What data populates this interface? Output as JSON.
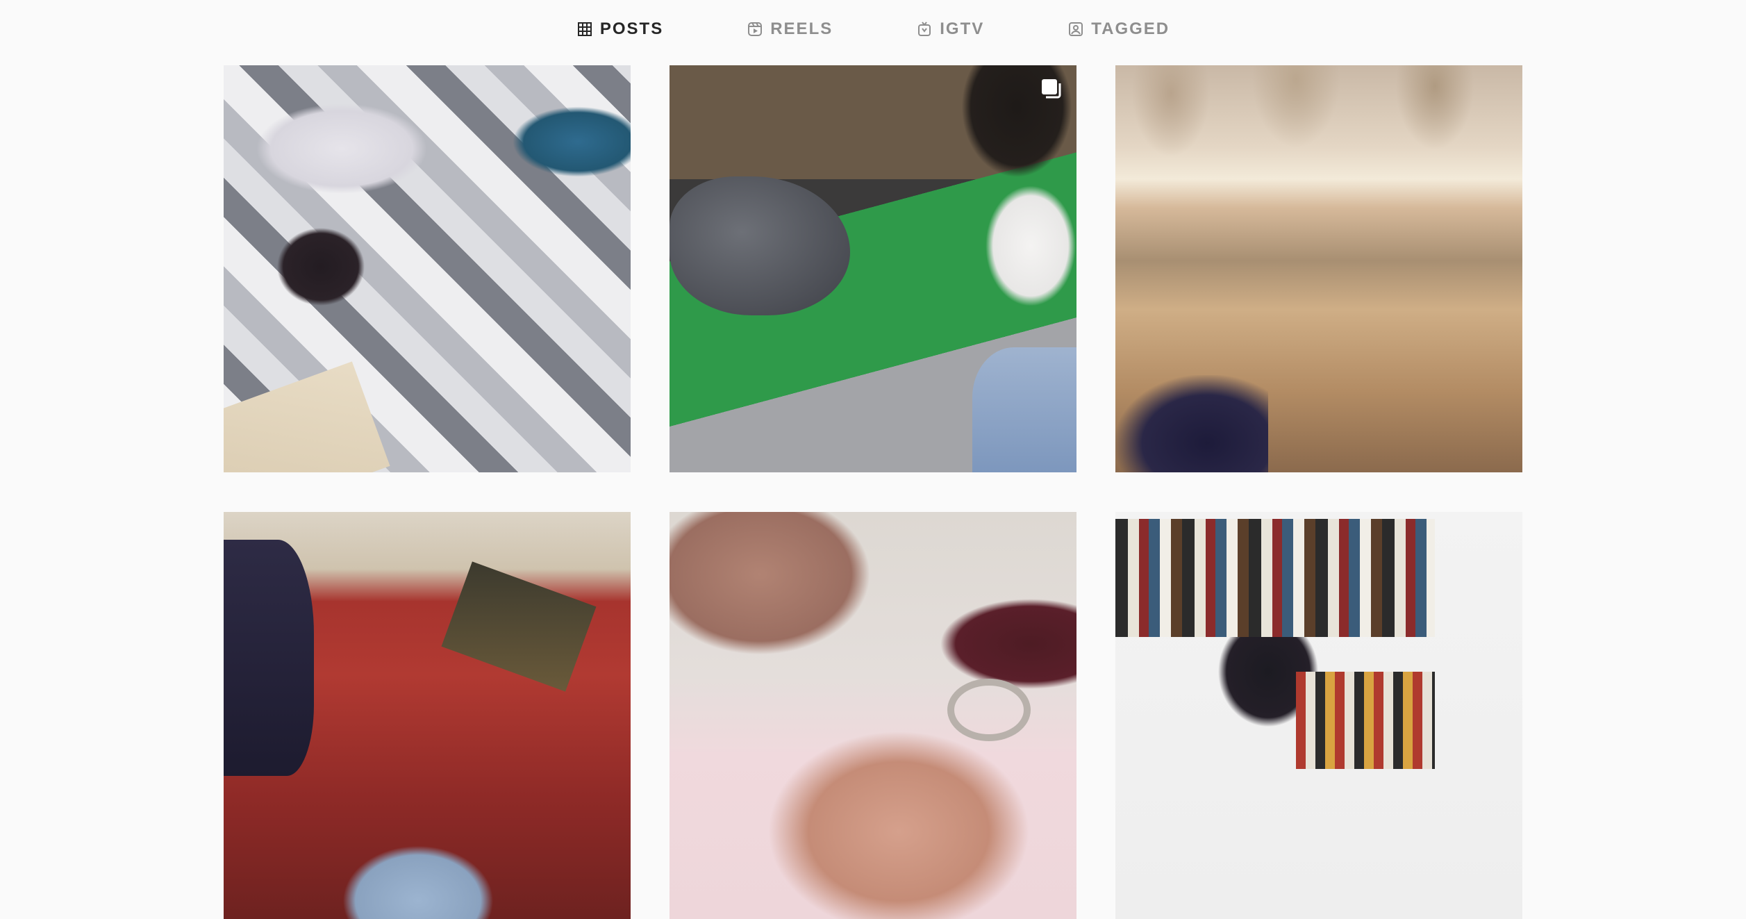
{
  "tabs": [
    {
      "label": "POSTS",
      "icon": "grid-icon",
      "active": true
    },
    {
      "label": "REELS",
      "icon": "reels-icon",
      "active": false
    },
    {
      "label": "IGTV",
      "icon": "igtv-icon",
      "active": false
    },
    {
      "label": "TAGGED",
      "icon": "tagged-icon",
      "active": false
    }
  ],
  "colors": {
    "background": "#fafafa",
    "active_tab": "#262626",
    "inactive_tab": "#8e8e8e"
  },
  "posts": [
    {
      "description": "children lying on patterned rug",
      "multi": false
    },
    {
      "description": "children playing with box diorama",
      "multi": true,
      "multi_icon": "carousel-icon"
    },
    {
      "description": "mosque courtyard with umbrellas",
      "multi": false
    },
    {
      "description": "Quran on stand in mosque with baby",
      "multi": false
    },
    {
      "description": "baby hand holding adult finger",
      "multi": false
    },
    {
      "description": "child in hijab by bookshelf",
      "multi": false
    }
  ]
}
